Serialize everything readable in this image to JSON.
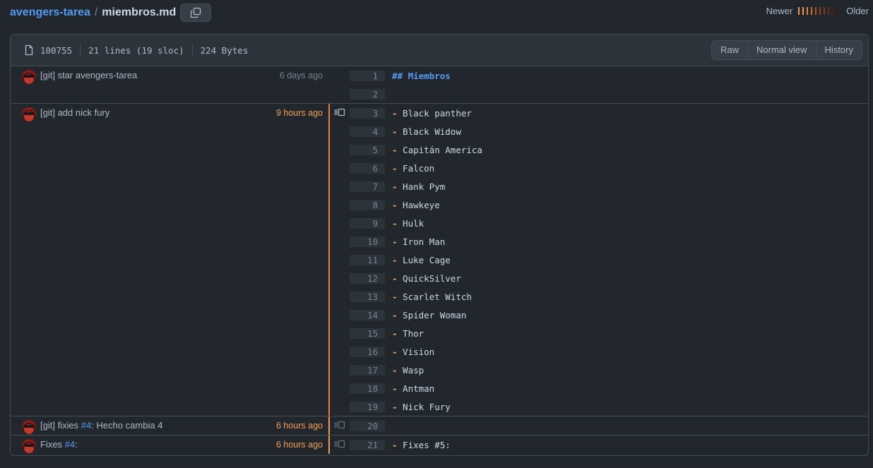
{
  "breadcrumb": {
    "repo": "avengers-tarea",
    "separator": "/",
    "file": "miembros.md"
  },
  "legend": {
    "newer": "Newer",
    "older": "Older",
    "colors": [
      "#f69d50",
      "#f69d50",
      "#e0823d",
      "#cc6b2c",
      "#ae5622",
      "#94471b",
      "#7f3913",
      "#682d0f",
      "#4d210c",
      "#3d1c0b"
    ]
  },
  "file_info": {
    "mode": "100755",
    "lines": "21 lines (19 sloc)",
    "size": "224 Bytes"
  },
  "buttons": {
    "raw": "Raw",
    "normal_view": "Normal view",
    "history": "History"
  },
  "hunks": [
    {
      "message_parts": [
        {
          "text": "[git] star avengers-tarea"
        }
      ],
      "time": "6 days ago",
      "time_color": "#768390",
      "heat": "#22272e",
      "reblame": false,
      "lines": [
        {
          "n": "1",
          "parts": [
            {
              "t": "## Miembros",
              "c": "hdr"
            }
          ]
        },
        {
          "n": "2",
          "parts": []
        }
      ]
    },
    {
      "message_parts": [
        {
          "text": "[git] add nick fury"
        }
      ],
      "time": "9 hours ago",
      "time_color": "#f69d50",
      "heat": "#e0823d",
      "reblame": true,
      "lines": [
        {
          "n": "3",
          "parts": [
            {
              "t": "-",
              "c": "dash"
            },
            {
              "t": " Black panther"
            }
          ]
        },
        {
          "n": "4",
          "parts": [
            {
              "t": "-",
              "c": "dash"
            },
            {
              "t": " Black Widow"
            }
          ]
        },
        {
          "n": "5",
          "parts": [
            {
              "t": "-",
              "c": "dash"
            },
            {
              "t": " Capitán America"
            }
          ]
        },
        {
          "n": "6",
          "parts": [
            {
              "t": "-",
              "c": "dash"
            },
            {
              "t": " Falcon"
            }
          ]
        },
        {
          "n": "7",
          "parts": [
            {
              "t": "-",
              "c": "dash"
            },
            {
              "t": " Hank Pym"
            }
          ]
        },
        {
          "n": "8",
          "parts": [
            {
              "t": "-",
              "c": "dash"
            },
            {
              "t": " Hawkeye"
            }
          ]
        },
        {
          "n": "9",
          "parts": [
            {
              "t": "-",
              "c": "dash"
            },
            {
              "t": " Hulk"
            }
          ]
        },
        {
          "n": "10",
          "parts": [
            {
              "t": "-",
              "c": "dash"
            },
            {
              "t": " Iron Man"
            }
          ]
        },
        {
          "n": "11",
          "parts": [
            {
              "t": "-",
              "c": "dash"
            },
            {
              "t": " Luke Cage"
            }
          ]
        },
        {
          "n": "12",
          "parts": [
            {
              "t": "-",
              "c": "dash"
            },
            {
              "t": " QuickSilver"
            }
          ]
        },
        {
          "n": "13",
          "parts": [
            {
              "t": "-",
              "c": "dash"
            },
            {
              "t": " Scarlet Witch"
            }
          ]
        },
        {
          "n": "14",
          "parts": [
            {
              "t": "-",
              "c": "dash"
            },
            {
              "t": " Spider Woman"
            }
          ]
        },
        {
          "n": "15",
          "parts": [
            {
              "t": "-",
              "c": "dash"
            },
            {
              "t": " Thor"
            }
          ]
        },
        {
          "n": "16",
          "parts": [
            {
              "t": "-",
              "c": "dash"
            },
            {
              "t": " Vision"
            }
          ]
        },
        {
          "n": "17",
          "parts": [
            {
              "t": "-",
              "c": "dash"
            },
            {
              "t": " Wasp"
            }
          ]
        },
        {
          "n": "18",
          "parts": [
            {
              "t": "-",
              "c": "dash"
            },
            {
              "t": " Antman"
            }
          ]
        },
        {
          "n": "19",
          "parts": [
            {
              "t": "-",
              "c": "dash"
            },
            {
              "t": " Nick Fury"
            }
          ]
        }
      ]
    },
    {
      "message_parts": [
        {
          "text": "[git] fixies "
        },
        {
          "text": "#4",
          "issue": true
        },
        {
          "text": ": Hecho cambia 4"
        }
      ],
      "time": "6 hours ago",
      "time_color": "#f69d50",
      "heat": "#f69d50",
      "reblame": true,
      "lines": [
        {
          "n": "20",
          "parts": []
        }
      ]
    },
    {
      "message_parts": [
        {
          "text": "Fixes "
        },
        {
          "text": "#4",
          "issue": true
        },
        {
          "text": ":"
        }
      ],
      "time": "6 hours ago",
      "time_color": "#f69d50",
      "heat": "#f69d50",
      "reblame": true,
      "lines": [
        {
          "n": "21",
          "parts": [
            {
              "t": "-",
              "c": "dash"
            },
            {
              "t": " Fixes #5:"
            }
          ]
        }
      ]
    }
  ]
}
